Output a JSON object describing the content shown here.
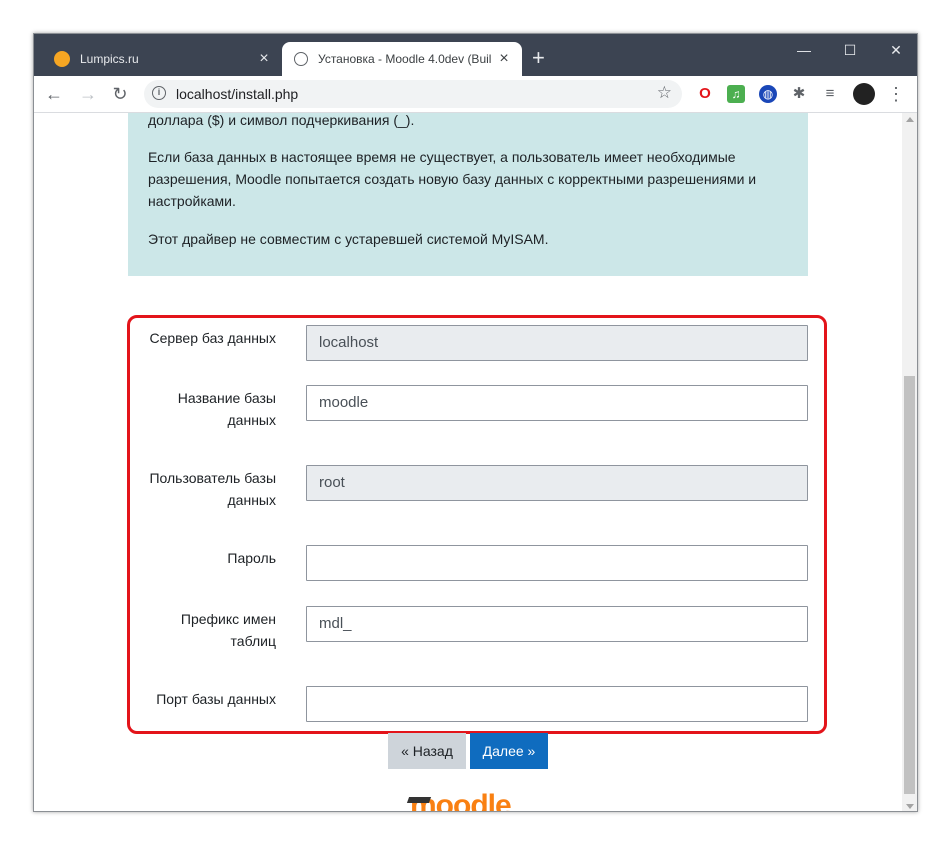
{
  "browser": {
    "tabs": [
      {
        "title": "Lumpics.ru",
        "favicon": "orange-circle-icon"
      },
      {
        "title": "Установка - Moodle 4.0dev (Buil",
        "favicon": "globe-icon"
      }
    ],
    "new_tab_label": "+",
    "window_controls": {
      "minimize": "—",
      "maximize": "☐",
      "close": "✕"
    },
    "url": "localhost/install.php",
    "extensions": [
      "opera-icon",
      "music-icon",
      "vpn-globe-icon",
      "puzzle-icon",
      "playlist-icon",
      "avatar"
    ]
  },
  "info": {
    "line1": "доллара ($) и символ подчеркивания (_).",
    "para2": "Если база данных в настоящее время не существует, а пользователь имеет необходимые разрешения, Moodle попытается создать новую базу данных с корректными разрешениями и настройками.",
    "para3": "Этот драйвер не совместим с устаревшей системой MyISAM."
  },
  "form": {
    "fields": [
      {
        "label": "Сервер баз данных",
        "value": "localhost",
        "readonly": true
      },
      {
        "label": "Название базы данных",
        "value": "moodle",
        "readonly": false
      },
      {
        "label": "Пользователь базы данных",
        "value": "root",
        "readonly": true
      },
      {
        "label": "Пароль",
        "value": "",
        "readonly": false
      },
      {
        "label": "Префикс имен таблиц",
        "value": "mdl_",
        "readonly": false
      },
      {
        "label": "Порт базы данных",
        "value": "",
        "readonly": false
      }
    ],
    "back_label": "« Назад",
    "next_label": "Далее »"
  },
  "logo_text": "moodle",
  "colors": {
    "highlight": "#e3141a",
    "primary": "#0f6cbf",
    "info_bg": "#cce7e8",
    "logo": "#f98012"
  }
}
